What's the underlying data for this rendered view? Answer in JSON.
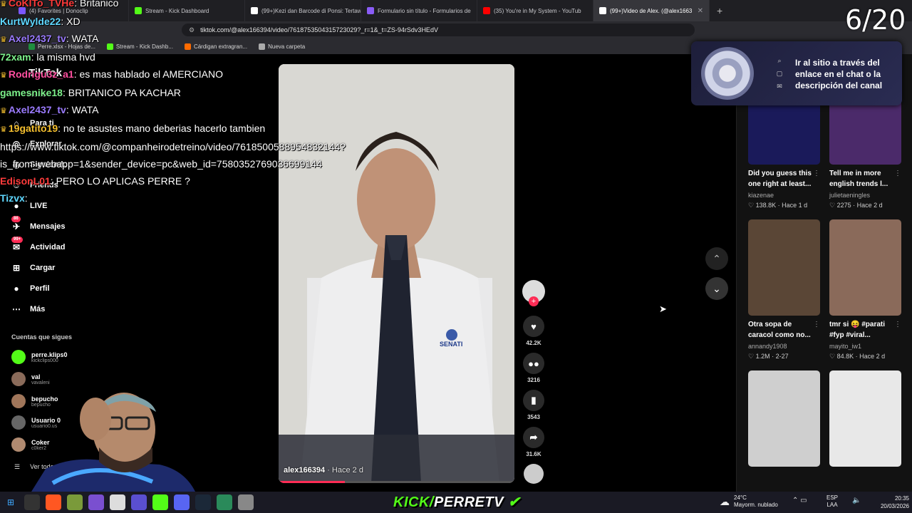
{
  "browser": {
    "tabs": [
      {
        "label": "(4) Favorites | Donoclip",
        "color": "#7b57ff",
        "active": false
      },
      {
        "label": "Stream - Kick Dashboard",
        "color": "#53fc18",
        "active": false
      },
      {
        "label": "(99+)Kezi dan Barcode di Ponsi: Tertaw",
        "color": "#ffffff",
        "active": false
      },
      {
        "label": "Formulario sin título - Formularios de",
        "color": "#8a5cf6",
        "active": false
      },
      {
        "label": "(35) You're in My System - YouTub",
        "color": "#ff0000",
        "active": false
      },
      {
        "label": "(99+)Video de Alex. (@alex1663",
        "color": "#ffffff",
        "active": true
      }
    ],
    "new_tab": "+",
    "url": "tiktok.com/@alex166394/video/7618753504315723029?_r=1&_t=ZS-94rSdv3HEdV",
    "bookmarks": [
      {
        "label": "Perre.xlsx - Hojas de...",
        "color": "#1e8e3e"
      },
      {
        "label": "Stream - Kick Dashb...",
        "color": "#53fc18"
      },
      {
        "label": "Cárdigan extragran...",
        "color": "#ff6b00"
      },
      {
        "label": "Nueva carpeta",
        "color": "#aaaaaa"
      }
    ]
  },
  "sidebar": {
    "logo": "TikTok",
    "search_placeholder": "Buscar",
    "items": [
      {
        "label": "Para ti",
        "icon": "home-icon"
      },
      {
        "label": "Explorar",
        "icon": "compass-icon"
      },
      {
        "label": "Siguiendo",
        "icon": "following-icon"
      },
      {
        "label": "Friends",
        "icon": "friends-icon"
      },
      {
        "label": "LIVE",
        "icon": "live-icon"
      },
      {
        "label": "Mensajes",
        "icon": "message-icon",
        "badge": "86"
      },
      {
        "label": "Actividad",
        "icon": "activity-icon",
        "badge": "99+"
      },
      {
        "label": "Cargar",
        "icon": "upload-icon"
      },
      {
        "label": "Perfil",
        "icon": "profile-icon"
      },
      {
        "label": "Más",
        "icon": "more-icon"
      }
    ],
    "following_title": "Cuentas que sigues",
    "following": [
      {
        "name": "perre.klips0",
        "handle": "kickclips000",
        "color": "#53fc18"
      },
      {
        "name": "val",
        "handle": "vavaleni",
        "color": "#8a6b5a"
      },
      {
        "name": "bepucho",
        "handle": "bepucho",
        "color": "#a0765a"
      },
      {
        "name": "Usuario 0",
        "handle": "usuario0.us",
        "color": "#666"
      },
      {
        "name": "Coker",
        "handle": "c0ker2",
        "color": "#b08a70"
      }
    ],
    "see_all": "Ver todo"
  },
  "chat": [
    {
      "user": "CoKITo_TVHe",
      "msg": "Britanico",
      "color": "#ff3b3b",
      "badges": true
    },
    {
      "user": "KurtWylde22",
      "msg": "XD",
      "color": "#5fd7ff",
      "badges": false
    },
    {
      "user": "Axel2437_tv",
      "msg": "WATA",
      "color": "#9b7bff",
      "badges": true
    },
    {
      "user": "72xam",
      "msg": "la misma hvd",
      "color": "#7cf08a",
      "badges": false
    },
    {
      "user": "Rodrigu3z_a1",
      "msg": "es mas hablado el AMERCIANO",
      "color": "#ff4fa0",
      "badges": true
    },
    {
      "user": "gamesnike18",
      "msg": "BRITANICO PA KACHAR",
      "color": "#7cf08a",
      "badges": false
    },
    {
      "user": "Axel2437_tv",
      "msg": "WATA",
      "color": "#9b7bff",
      "badges": true
    },
    {
      "user": "19gatito19",
      "msg": "no te asustes mano deberias hacerlo tambien",
      "color": "#f6c02f",
      "badges": true
    },
    {
      "user": "",
      "msg": "https://www.tiktok.com/@companheirodetreino/video/7618500588954832144?",
      "color": "#ffffff",
      "badges": false
    },
    {
      "user": "",
      "msg": "is_from_webapp=1&sender_device=pc&web_id=7580352769036699144",
      "color": "#ffffff",
      "badges": false
    },
    {
      "user": "EdisonL01",
      "msg": "PERO LO APLICAS PERRE ?",
      "color": "#ff3b3b",
      "badges": false
    },
    {
      "user": "Tizvx",
      "msg": "",
      "color": "#5fd7ff",
      "badges": false
    }
  ],
  "video": {
    "author": "alex166394",
    "age": "· Hace 2 d",
    "progress": 0.28,
    "badge_text": "SENATI",
    "actions": [
      {
        "icon": "heart-icon",
        "count": "42.2K"
      },
      {
        "icon": "comment-icon",
        "count": "3216"
      },
      {
        "icon": "bookmark-icon",
        "count": "3543"
      },
      {
        "icon": "share-icon",
        "count": "31.6K"
      }
    ]
  },
  "promo": {
    "text": "Ir al sitio a través del enlace en el chat o la descripción del canal"
  },
  "counter": "6/20",
  "feed": [
    {
      "desc": "Did you guess this",
      "desc2": "one right at least...",
      "author": "kiazenae",
      "likes": "138.8K",
      "age": "Hace 1 d",
      "color": "#1a1a5a"
    },
    {
      "desc": "Tell me in more",
      "desc2": "english trends l...",
      "author": "julietaeningles",
      "likes": "2275",
      "age": "Hace 2 d",
      "color": "#4b2a6a"
    },
    {
      "desc": "Otra sopa de",
      "desc2": "caracol como no...",
      "author": "annandy1908",
      "likes": "1.2M",
      "age": "2-27",
      "color": "#5a4636"
    },
    {
      "desc": "tmr si 😝 #parati",
      "desc2": "#fyp #viral...",
      "author": "mayito_iw1",
      "likes": "84.8K",
      "age": "Hace 2 d",
      "color": "#8a6a5a"
    },
    {
      "desc": "",
      "desc2": "",
      "author": "",
      "likes": "",
      "age": "",
      "color": "#cfcfcf"
    },
    {
      "desc": "",
      "desc2": "",
      "author": "",
      "likes": "",
      "age": "",
      "color": "#e8e8e8"
    }
  ],
  "taskbar": {
    "brand_green": "KICK/",
    "brand_white": "PERRETV",
    "temp": "24°C",
    "weather": "Mayorm. nublado",
    "lang": "ESP",
    "lang2": "LAA",
    "time": "20:35",
    "date": "20/03/2026"
  }
}
